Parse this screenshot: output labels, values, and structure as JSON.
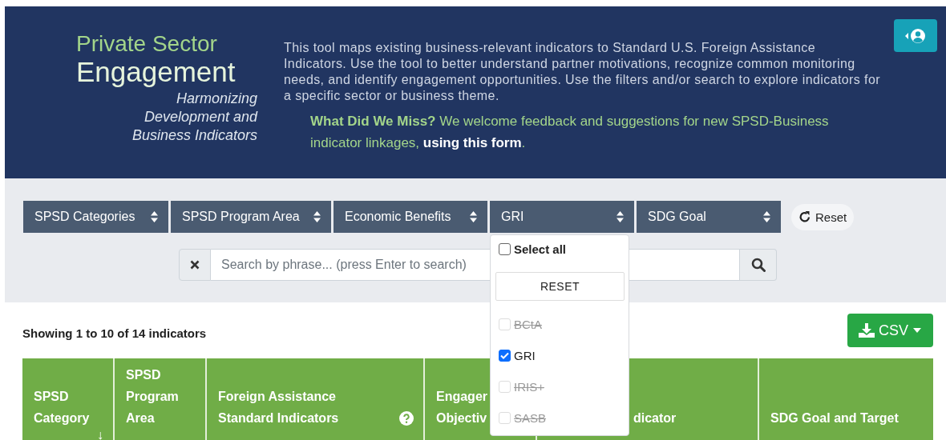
{
  "header": {
    "title_line1": "Private Sector",
    "title_line2": "Engagement",
    "subtitle": "Harmonizing Development and Business Indicators",
    "description": "This tool maps existing business-relevant indicators to Standard U.S. Foreign Assistance Indicators. Use the tool to better understand partner motivations, recognize common monitoring needs, and identify engagement opportunities. Use the filters and/or search to explore indicators for a specific sector or business theme.",
    "feedback": "**What Did We Miss?** We welcome feedback and suggestions for new SPSD-Business indicator linkages, ",
    "feedback_link": "using this form",
    "feedback_end": "."
  },
  "filters": [
    {
      "label": "SPSD Categories"
    },
    {
      "label": "SPSD Program Area"
    },
    {
      "label": "Economic Benefits"
    },
    {
      "label": "GRI",
      "menu": {
        "select_all": {
          "label": "Select all",
          "checked": false
        },
        "reset": "RESET",
        "options": [
          {
            "label": "BCtA",
            "checked": false,
            "disabled": true
          },
          {
            "label": "GRI",
            "checked": true,
            "disabled": false
          },
          {
            "label": "IRIS+",
            "checked": false,
            "disabled": true
          },
          {
            "label": "SASB",
            "checked": false,
            "disabled": true
          }
        ]
      }
    },
    {
      "label": "SDG Goal"
    }
  ],
  "reset_button": "Reset",
  "search": {
    "placeholder": "Search by phrase... (press Enter to search)"
  },
  "status": "Showing 1 to 10 of 14 indicators",
  "export_button": "CSV",
  "table": {
    "columns": [
      {
        "label": "SPSD Category",
        "sort_mark": "↓"
      },
      {
        "label": "SPSD Program Area"
      },
      {
        "label": "Foreign Assistance Standard Indicators",
        "help": true
      },
      {
        "label": "Engager Objectiv"
      },
      {
        "label": "dicator"
      },
      {
        "label": "SDG Goal and Target"
      }
    ]
  }
}
